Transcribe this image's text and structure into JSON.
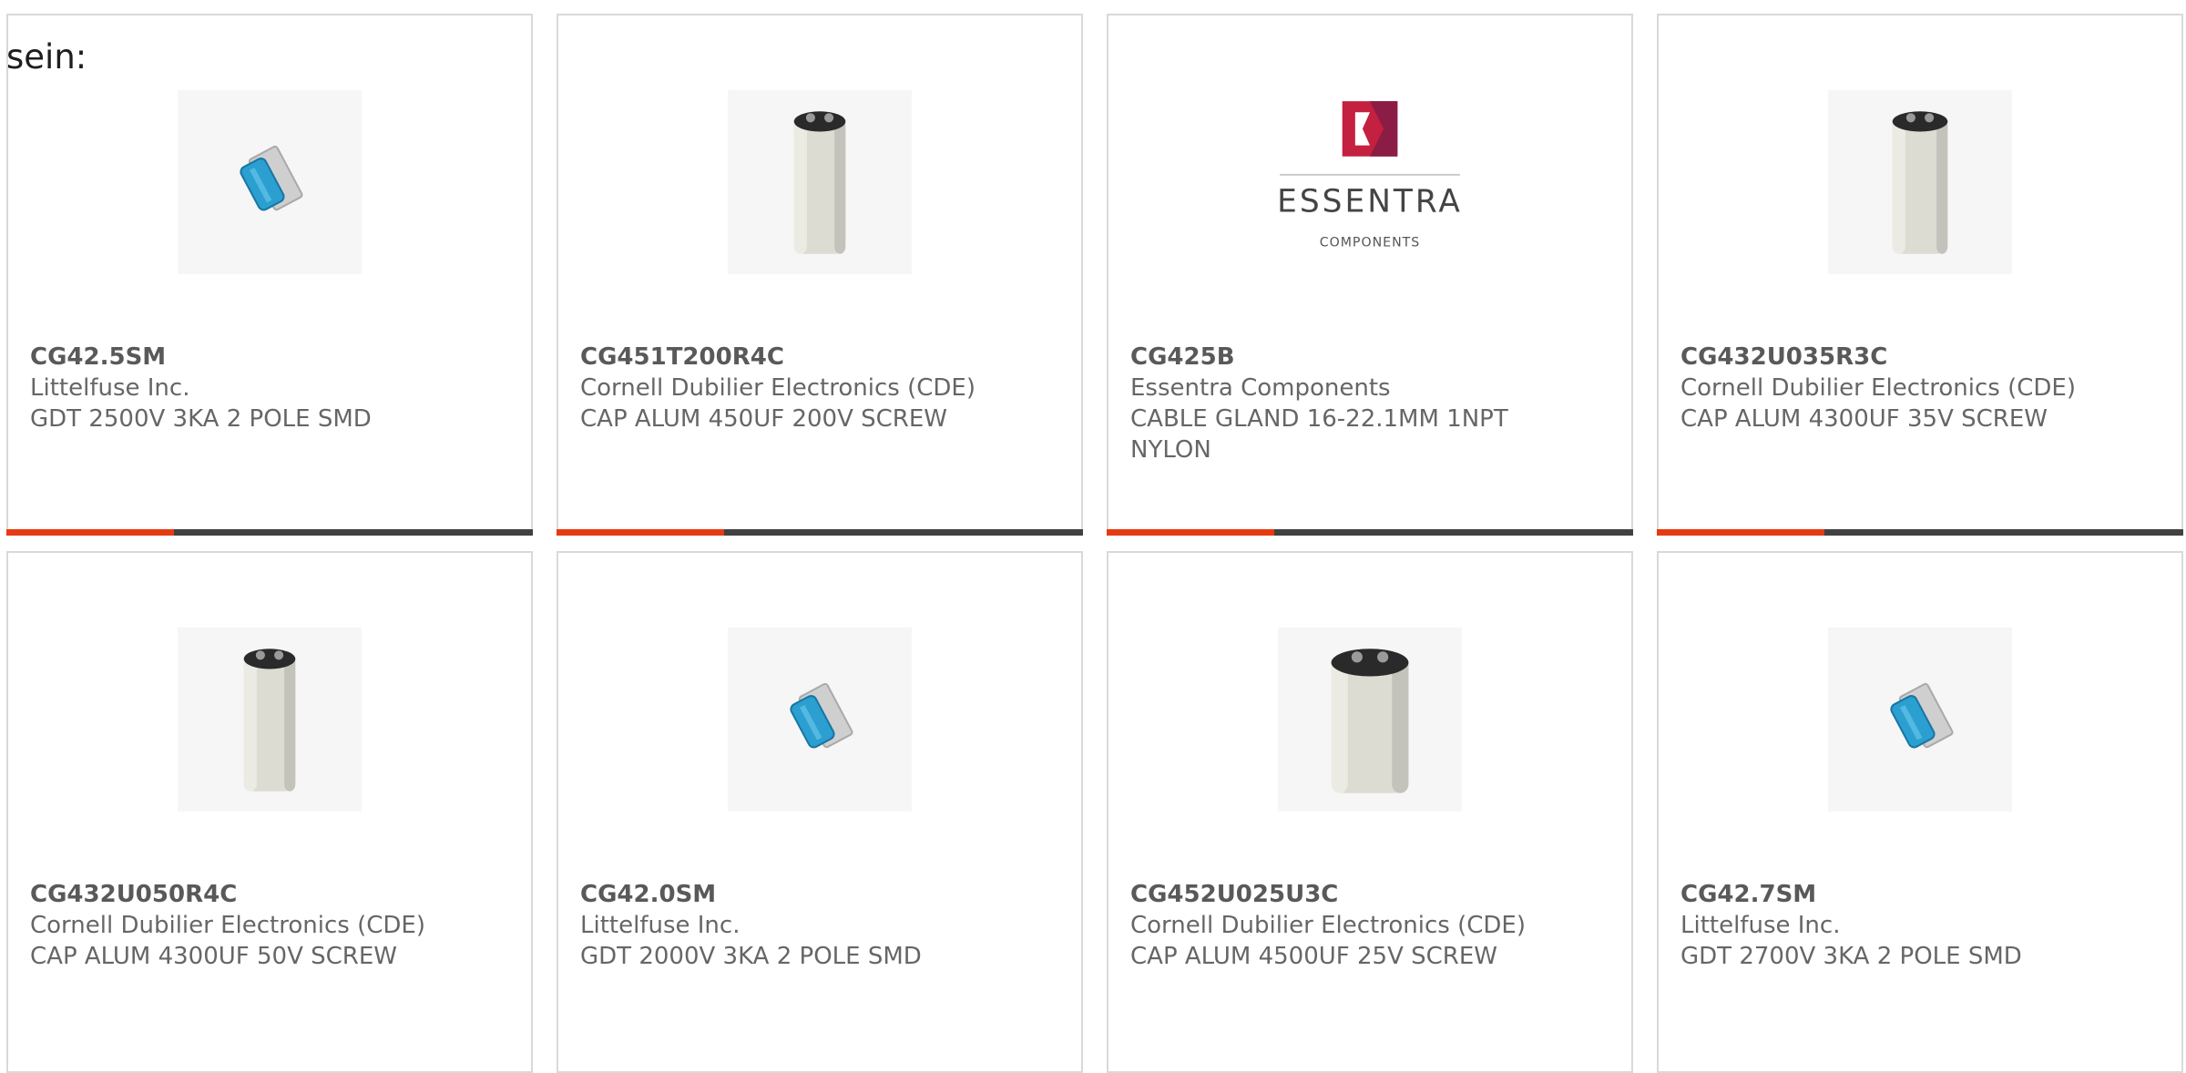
{
  "header": {
    "text": "sein:"
  },
  "colors": {
    "accent": "#e63b12",
    "bar": "#414141",
    "border": "#d9d9d9",
    "text": "#666666"
  },
  "products": [
    {
      "part": "CG42.5SM",
      "manufacturer": "Littelfuse Inc.",
      "description": "GDT 2500V 3KA 2 POLE SMD",
      "image": "gdt-smd-icon"
    },
    {
      "part": "CG451T200R4C",
      "manufacturer": "Cornell Dubilier Electronics (CDE)",
      "description": "CAP ALUM 450UF 200V SCREW",
      "image": "capacitor-icon"
    },
    {
      "part": "CG425B",
      "manufacturer": "Essentra Components",
      "description": "CABLE GLAND 16-22.1MM 1NPT NYLON",
      "image": "essentra-logo",
      "logo_text": "ESSENTRA",
      "logo_subtext": "COMPONENTS"
    },
    {
      "part": "CG432U035R3C",
      "manufacturer": "Cornell Dubilier Electronics (CDE)",
      "description": "CAP ALUM 4300UF 35V SCREW",
      "image": "capacitor-icon"
    },
    {
      "part": "CG432U050R4C",
      "manufacturer": "Cornell Dubilier Electronics (CDE)",
      "description": "CAP ALUM 4300UF 50V SCREW",
      "image": "capacitor-icon"
    },
    {
      "part": "CG42.0SM",
      "manufacturer": "Littelfuse Inc.",
      "description": "GDT 2000V 3KA 2 POLE SMD",
      "image": "gdt-smd-icon"
    },
    {
      "part": "CG452U025U3C",
      "manufacturer": "Cornell Dubilier Electronics (CDE)",
      "description": "CAP ALUM 4500UF 25V SCREW",
      "image": "capacitor-wide-icon"
    },
    {
      "part": "CG42.7SM",
      "manufacturer": "Littelfuse Inc.",
      "description": "GDT 2700V 3KA 2 POLE SMD",
      "image": "gdt-smd-icon"
    }
  ]
}
